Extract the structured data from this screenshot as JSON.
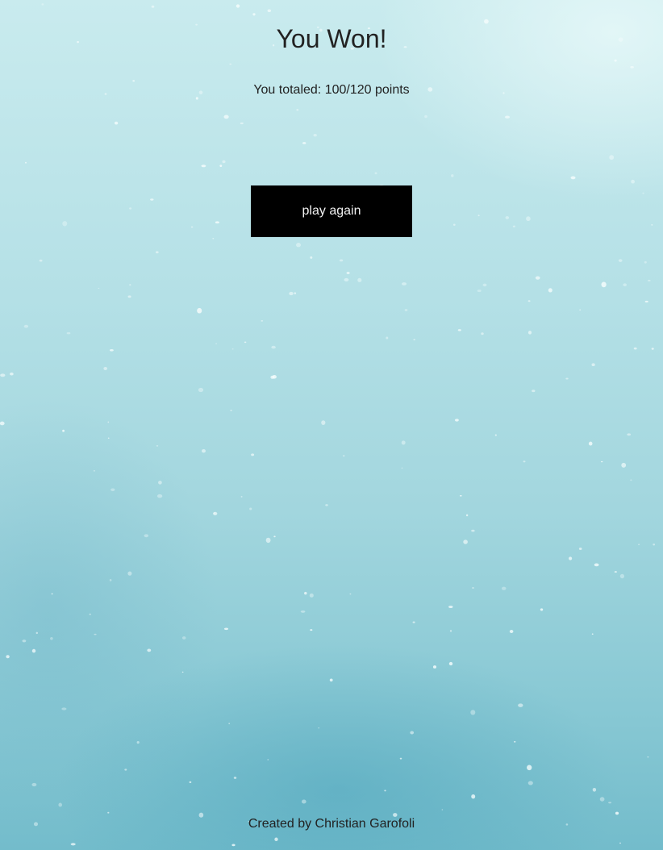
{
  "result": {
    "title": "You Won!",
    "score_text": "You totaled: 100/120 points"
  },
  "actions": {
    "play_again_label": "play again"
  },
  "footer": {
    "credit": "Created by Christian Garofoli"
  },
  "colors": {
    "button_bg": "#000000",
    "button_text": "#f2f2f2",
    "background_top": "#c9ebee",
    "background_bottom": "#73bccb"
  }
}
